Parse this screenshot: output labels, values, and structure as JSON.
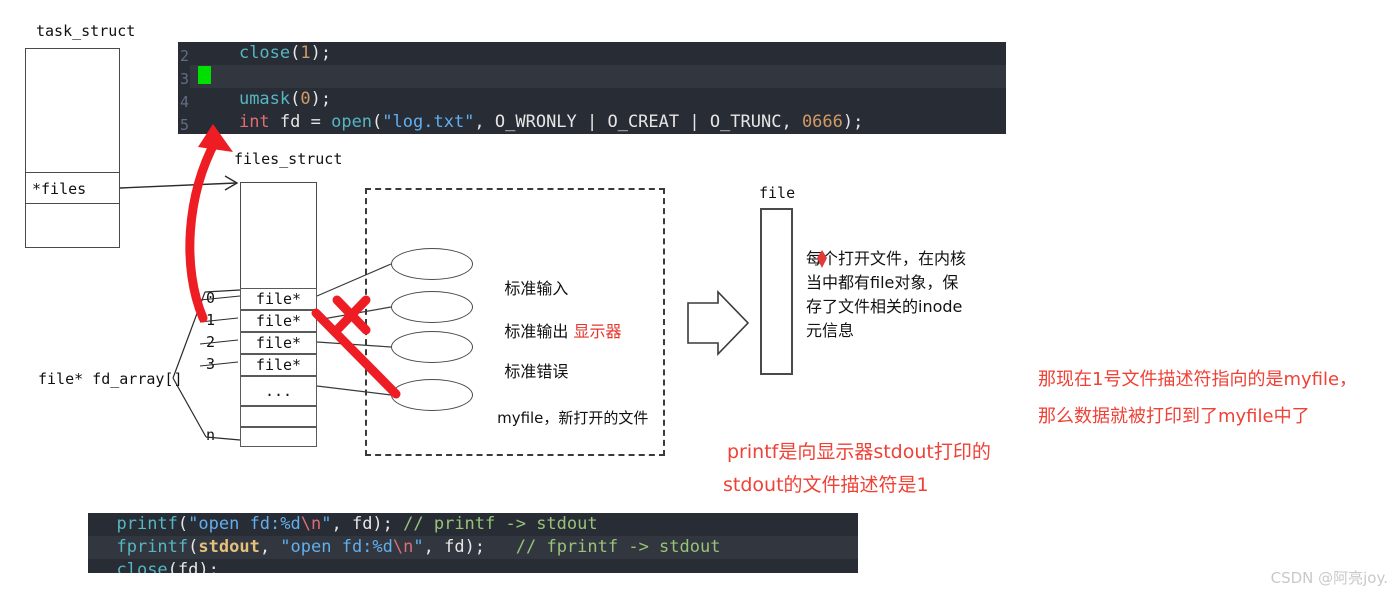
{
  "diagram": {
    "title_task_struct": "task_struct",
    "title_files_struct": "files_struct",
    "title_file": "file",
    "files_ptr_label": "*files",
    "fd_array_label": "file* fd_array[]",
    "fd_indices": [
      "0",
      "1",
      "2",
      "3",
      "n"
    ],
    "fd_cells": [
      "file*",
      "file*",
      "file*",
      "file*",
      "..."
    ],
    "ellipse_labels": [
      {
        "text": "标准输入",
        "red_suffix": ""
      },
      {
        "text": "标准输出 ",
        "red_suffix": "显示器"
      },
      {
        "text": "标准错误",
        "red_suffix": ""
      },
      {
        "text": "myfile，新打开的文件",
        "red_suffix": ""
      }
    ],
    "file_note": "每个打开文件，在内核\n当中都有file对象，保\n存了文件相关的inode\n元信息"
  },
  "annotations": {
    "note_right_line1": "那现在1号文件描述符指向的是myfile，",
    "note_right_line2": "那么数据就被打印到了myfile中了",
    "note_mid_line1": "printf是向显示器stdout打印的",
    "note_mid_line2": "stdout的文件描述符是1"
  },
  "code_top": {
    "lines": [
      {
        "num": "2",
        "highlight": false,
        "tokens": [
          {
            "t": "    ",
            "c": "plain"
          },
          {
            "t": "close",
            "c": "fn"
          },
          {
            "t": "(",
            "c": "white"
          },
          {
            "t": "1",
            "c": "num2"
          },
          {
            "t": ");",
            "c": "white"
          }
        ]
      },
      {
        "num": "3",
        "highlight": true,
        "tokens": [
          {
            "t": "",
            "c": "cursor"
          }
        ]
      },
      {
        "num": "4",
        "highlight": false,
        "tokens": [
          {
            "t": "    ",
            "c": "plain"
          },
          {
            "t": "umask",
            "c": "fn"
          },
          {
            "t": "(",
            "c": "white"
          },
          {
            "t": "0",
            "c": "num2"
          },
          {
            "t": ");",
            "c": "white"
          }
        ]
      },
      {
        "num": "5",
        "highlight": false,
        "tokens": [
          {
            "t": "    ",
            "c": "plain"
          },
          {
            "t": "int",
            "c": "kw"
          },
          {
            "t": " fd = ",
            "c": "white"
          },
          {
            "t": "open",
            "c": "fn"
          },
          {
            "t": "(",
            "c": "white"
          },
          {
            "t": "\"log.txt\"",
            "c": "str"
          },
          {
            "t": ", O_WRONLY | O_CREAT | O_TRUNC, ",
            "c": "white"
          },
          {
            "t": "0666",
            "c": "num2"
          },
          {
            "t": ");",
            "c": "white"
          }
        ]
      }
    ]
  },
  "code_bottom": {
    "lines": [
      {
        "num": "",
        "highlight": false,
        "tokens": [
          {
            "t": "  ",
            "c": "plain"
          },
          {
            "t": "printf",
            "c": "fn"
          },
          {
            "t": "(",
            "c": "white"
          },
          {
            "t": "\"open fd:%d",
            "c": "str"
          },
          {
            "t": "\\n",
            "c": "esc"
          },
          {
            "t": "\"",
            "c": "str"
          },
          {
            "t": ", fd); ",
            "c": "white"
          },
          {
            "t": "// printf -> stdout",
            "c": "cmt"
          }
        ]
      },
      {
        "num": "",
        "highlight": true,
        "tokens": [
          {
            "t": "  ",
            "c": "plain"
          },
          {
            "t": "fprintf",
            "c": "fn"
          },
          {
            "t": "(",
            "c": "white"
          },
          {
            "t": "stdout",
            "c": "var"
          },
          {
            "t": ", ",
            "c": "white"
          },
          {
            "t": "\"open fd:%d",
            "c": "str"
          },
          {
            "t": "\\n",
            "c": "esc"
          },
          {
            "t": "\"",
            "c": "str"
          },
          {
            "t": ", fd);   ",
            "c": "white"
          },
          {
            "t": "// fprintf -> stdout",
            "c": "cmt"
          }
        ]
      },
      {
        "num": "",
        "highlight": false,
        "tokens": [
          {
            "t": "  ",
            "c": "plain"
          },
          {
            "t": "close",
            "c": "fn"
          },
          {
            "t": "(fd);",
            "c": "white"
          }
        ]
      }
    ]
  },
  "watermark": "CSDN @阿亮joy.",
  "colors": {
    "red_accent": "#ef4136",
    "code_bg": "#282c34",
    "cursor_green": "#00e000"
  }
}
